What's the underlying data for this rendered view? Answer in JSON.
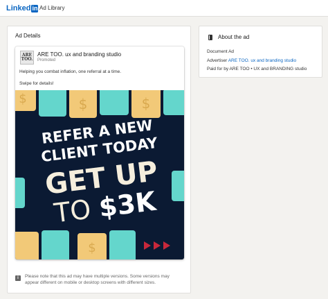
{
  "header": {
    "logo_text": "Linked",
    "logo_in": "in",
    "app_title": "Ad Library"
  },
  "ad_details": {
    "heading": "Ad Details",
    "advertiser_name": "ARE TOO. ux and branding studio",
    "avatar_text": "ARE TOO.",
    "promoted_label": "Promoted",
    "body_line1": "Helping you combat inflation, one referral at a time.",
    "body_line2": "Swipe for details!",
    "creative": {
      "line1": "REFER A NEW",
      "line2": "CLIENT TODAY",
      "line3": "GET UP",
      "line4a": "TO ",
      "line4b": "$3K",
      "coin_symbol": "$",
      "colors": {
        "background": "#0b1a33",
        "teal": "#64d6cc",
        "yellow": "#f2c978",
        "red": "#c8283b",
        "text_white": "#ffffff",
        "text_cream": "#f5eedd"
      }
    },
    "note": "Please note that this ad may have multiple versions. Some versions may appear different on mobile or desktop screens with different sizes."
  },
  "about": {
    "title": "About the ad",
    "type": "Document Ad",
    "advertiser_label": "Advertiser",
    "advertiser_link": "ARE TOO. ux and branding studio",
    "paid_for": "Paid for by ARE TOO • UX and BRANDING studio"
  },
  "icons": {
    "about": "document-icon",
    "note": "info-icon"
  }
}
